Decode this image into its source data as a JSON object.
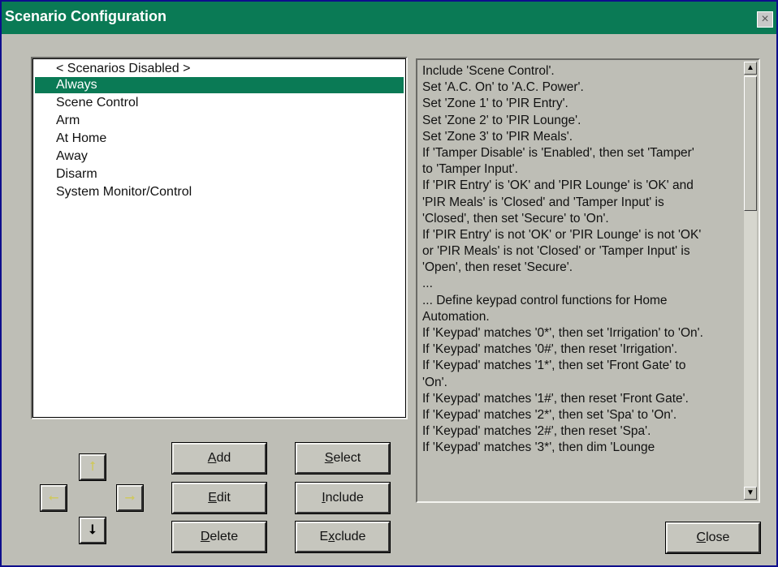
{
  "window": {
    "title": "Scenario Configuration",
    "close_glyph": "×"
  },
  "scenario_list": {
    "items": [
      {
        "label": "< Scenarios Disabled >",
        "selected": false
      },
      {
        "label": "Always",
        "selected": true
      },
      {
        "label": "Scene Control",
        "selected": false
      },
      {
        "label": "Arm",
        "selected": false
      },
      {
        "label": "At Home",
        "selected": false
      },
      {
        "label": "Away",
        "selected": false
      },
      {
        "label": "Disarm",
        "selected": false
      },
      {
        "label": "System Monitor/Control",
        "selected": false
      }
    ]
  },
  "script": {
    "lines": [
      "Include 'Scene Control'.",
      "Set 'A.C. On' to 'A.C. Power'.",
      "Set 'Zone 1' to 'PIR Entry'.",
      "Set 'Zone 2' to 'PIR Lounge'.",
      "Set 'Zone 3' to 'PIR Meals'.",
      "If 'Tamper Disable' is 'Enabled', then set 'Tamper'",
      "to 'Tamper Input'.",
      "If 'PIR Entry' is 'OK' and 'PIR Lounge' is 'OK' and",
      "'PIR Meals' is 'Closed' and 'Tamper Input' is",
      "'Closed', then set 'Secure' to 'On'.",
      "If 'PIR Entry' is not 'OK' or 'PIR Lounge' is not 'OK'",
      "or 'PIR Meals' is not 'Closed' or 'Tamper Input' is",
      "'Open', then reset 'Secure'.",
      "...",
      "... Define keypad control functions for Home",
      "Automation.",
      "If 'Keypad' matches '0*', then set 'Irrigation' to 'On'.",
      "If 'Keypad' matches '0#', then reset 'Irrigation'.",
      "If 'Keypad' matches '1*', then set 'Front Gate' to",
      "'On'.",
      "If 'Keypad' matches '1#', then reset 'Front Gate'.",
      "If 'Keypad' matches '2*', then set 'Spa' to 'On'.",
      "If 'Keypad' matches '2#', then reset 'Spa'.",
      "If 'Keypad' matches '3*', then dim 'Lounge"
    ],
    "scroll_up_glyph": "▲",
    "scroll_down_glyph": "▼"
  },
  "arrows": {
    "up": "⭡",
    "left": "⭠",
    "right": "⭢",
    "down": "⭣"
  },
  "buttons": {
    "add": {
      "mnemonic": "A",
      "rest": "dd"
    },
    "edit": {
      "mnemonic": "E",
      "rest": "dit"
    },
    "delete": {
      "mnemonic": "D",
      "rest": "elete"
    },
    "select": {
      "mnemonic": "S",
      "rest": "elect"
    },
    "include": {
      "mnemonic": "I",
      "rest": "nclude"
    },
    "exclude": {
      "pre": "E",
      "mnemonic": "x",
      "rest": "clude"
    },
    "close": {
      "mnemonic": "C",
      "rest": "lose"
    }
  },
  "colors": {
    "desktop": "#0e0e8c",
    "titlebar": "#0a7a55",
    "selection": "#0a7a55",
    "face": "#bebeb6",
    "disabled_arrow": "#cfc860"
  }
}
